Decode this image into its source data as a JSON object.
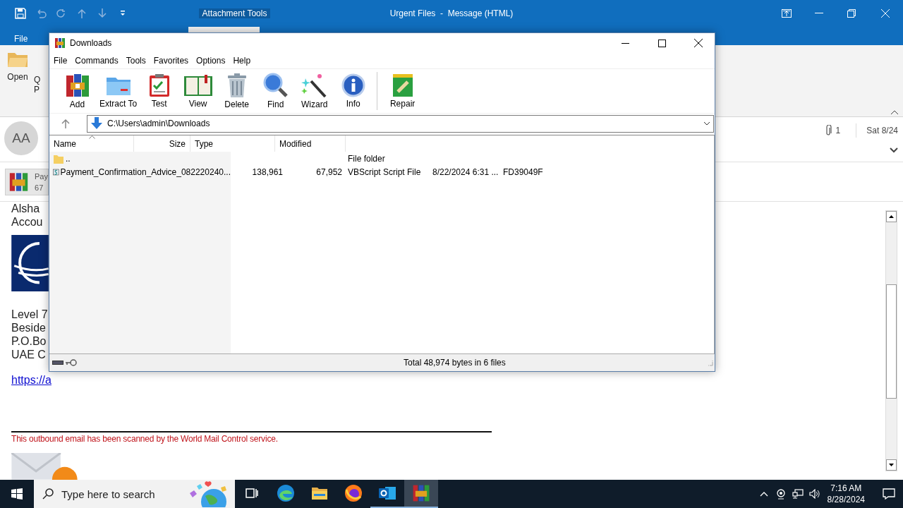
{
  "outlook": {
    "title": "Urgent Files  -  Message (HTML)",
    "contextual_tab": "Attachment Tools",
    "ribbon_tabs": [
      {
        "label": "File",
        "selected": false
      }
    ],
    "ribbon_buttons": [
      {
        "label": "Open"
      },
      {
        "label": "Q",
        "line_2": "P"
      }
    ],
    "header": {
      "avatar": "AA",
      "attachment_count": "1",
      "date": "Sat 8/24"
    },
    "attachment": {
      "name": "Pay",
      "size": "67"
    },
    "body": {
      "lines": [
        "Alsha",
        "Accou"
      ],
      "address": [
        "Level 7",
        "Beside",
        "P.O.Bo",
        "UAE C"
      ],
      "link": "https://a",
      "disclaimer": "This outbound email has been scanned by the World Mail Control service."
    }
  },
  "winrar": {
    "title": "Downloads",
    "menu": [
      "File",
      "Commands",
      "Tools",
      "Favorites",
      "Options",
      "Help"
    ],
    "toolbar": [
      [
        "Add",
        "Extract To",
        "Test",
        "View",
        "Delete",
        "Find",
        "Wizard",
        "Info"
      ],
      [
        "Repair"
      ]
    ],
    "path": "C:\\Users\\admin\\Downloads",
    "columns": [
      {
        "label": "Name",
        "sorted": true
      },
      {
        "label": "Size",
        "sorted": false
      },
      {
        "label": "Type",
        "sorted": false
      },
      {
        "label": "Modified",
        "sorted": false
      }
    ],
    "rows": [
      {
        "kind": "folder",
        "selected": false,
        "name": "..",
        "column_4": "File folder"
      },
      {
        "kind": "script",
        "selected": false,
        "name": "Payment_Confirmation_Advice_082220240...",
        "column_2": "138,961",
        "column_3": "67,952",
        "column_4": "VBScript Script File",
        "column_5": "8/22/2024 6:31 ...",
        "column_6": "FD39049F"
      }
    ],
    "status": "Total 48,974 bytes in 6 files"
  },
  "taskbar": {
    "search": {
      "placeholder": "Type here to search"
    },
    "apps": [
      {
        "selected": false,
        "running": false
      },
      {
        "selected": false,
        "running": false
      },
      {
        "selected": false,
        "running": false
      },
      {
        "selected": false,
        "running": false
      },
      {
        "selected": false,
        "running": true
      },
      {
        "selected": true,
        "running": true
      }
    ],
    "time": "7:16 AM",
    "date": "8/28/2024"
  }
}
